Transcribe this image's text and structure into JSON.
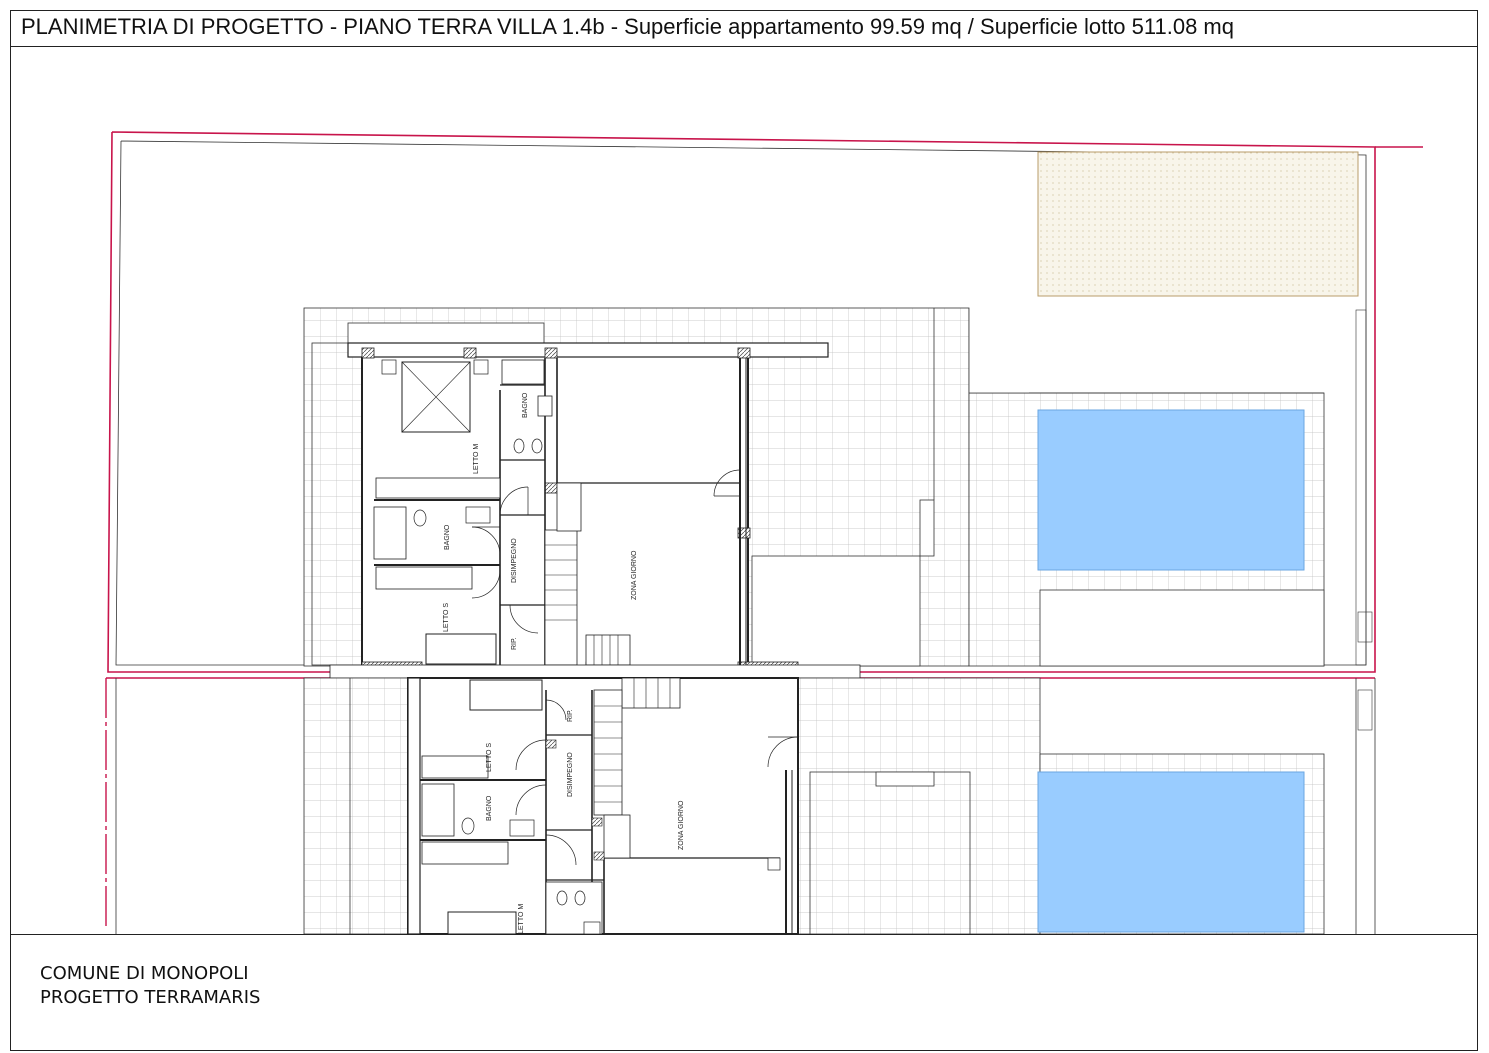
{
  "title": "PLANIMETRIA DI PROGETTO - PIANO TERRA VILLA 1.4b - Superficie appartamento 99.59 mq / Superficie lotto 511.08 mq",
  "footer": {
    "line1": "COMUNE DI MONOPOLI",
    "line2": "PROGETTO TERRAMARIS"
  },
  "rooms_upper": {
    "letto_m": "LETTO M",
    "bagno_1": "BAGNO",
    "bagno_2": "BAGNO",
    "disimpegno": "DISIMPEGNO",
    "letto_s": "LETTO S",
    "rip": "RIP.",
    "zona_giorno": "ZONA GIORNO"
  },
  "rooms_lower": {
    "letto_s": "LETTO S",
    "disimpegno": "DISIMPEGNO",
    "rip": "RIP.",
    "bagno": "BAGNO",
    "zona_giorno": "ZONA GIORNO",
    "letto_m": "LETTO M"
  },
  "colors": {
    "lot_boundary": "#c8144b",
    "pool": "#99ccff",
    "pool_border": "#6aa6e0",
    "garden_area": "#f7f3e6",
    "garden_border": "#b89c6a",
    "wall": "#222222"
  }
}
